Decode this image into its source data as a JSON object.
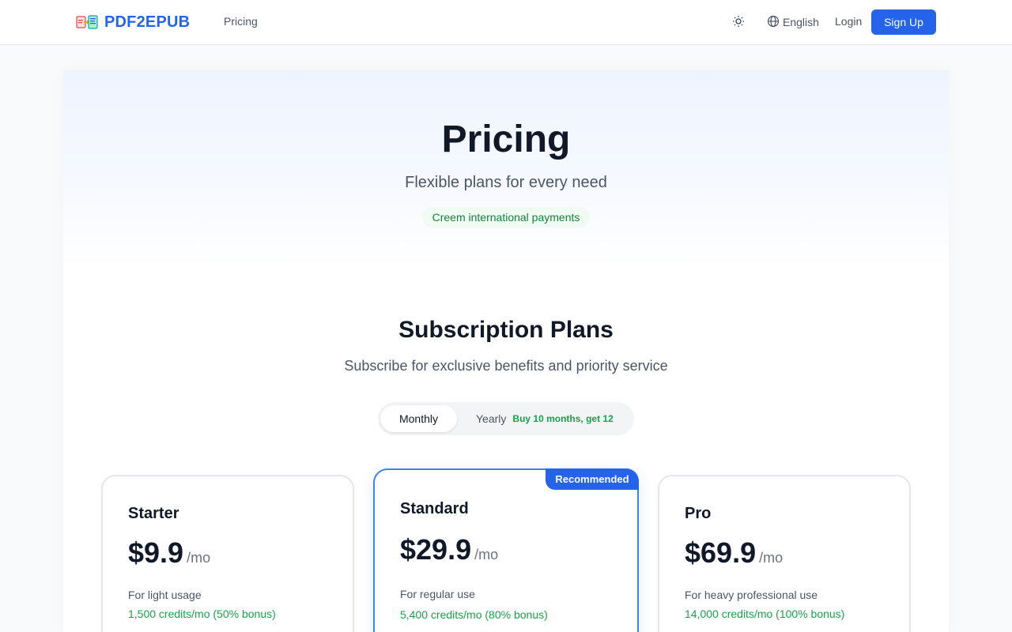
{
  "header": {
    "brand": "PDF2EPUB",
    "nav_pricing": "Pricing",
    "language": "English",
    "login": "Login",
    "signup": "Sign Up"
  },
  "hero": {
    "title": "Pricing",
    "subtitle": "Flexible plans for every need",
    "payment_badge": "Creem international payments"
  },
  "subscription": {
    "title": "Subscription Plans",
    "description": "Subscribe for exclusive benefits and priority service",
    "toggle": {
      "monthly": "Monthly",
      "yearly": "Yearly",
      "yearly_promo": "Buy 10 months, get 12",
      "selected": "Monthly"
    }
  },
  "plans": [
    {
      "name": "Starter",
      "price": "$9.9",
      "period": "/mo",
      "description": "For light usage",
      "credits": "1,500 credits/mo (50% bonus)"
    },
    {
      "name": "Standard",
      "price": "$29.9",
      "period": "/mo",
      "description": "For regular use",
      "credits": "5,400 credits/mo (80% bonus)",
      "badge": "Recommended"
    },
    {
      "name": "Pro",
      "price": "$69.9",
      "period": "/mo",
      "description": "For heavy professional use",
      "credits": "14,000 credits/mo (100% bonus)"
    }
  ],
  "icons": {
    "theme": "sun-icon",
    "language": "globe-icon",
    "logo": "pdf-to-epub-logo-icon"
  },
  "colors": {
    "primary": "#2563eb",
    "success": "#16a34a",
    "recommended_border": "#3b82f6"
  }
}
